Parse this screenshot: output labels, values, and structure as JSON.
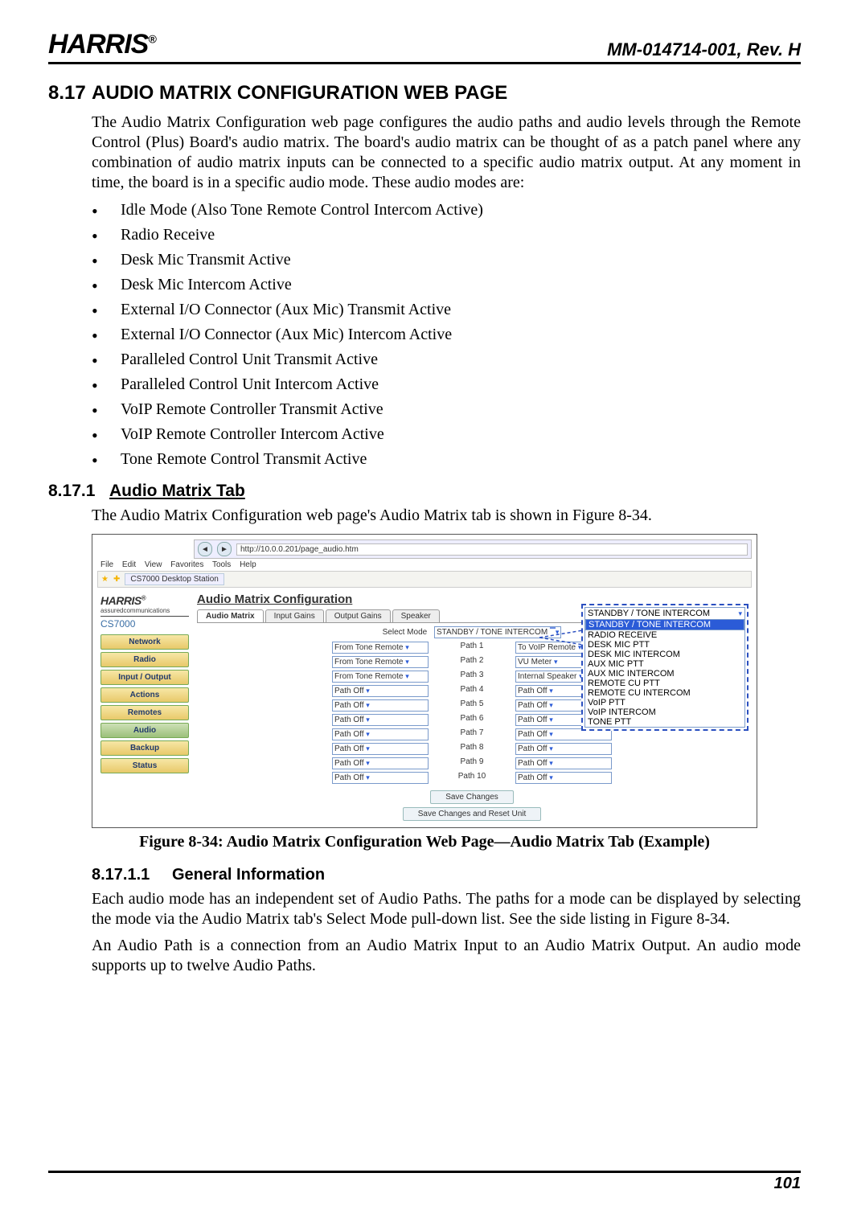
{
  "header": {
    "logo_text": "HARRIS",
    "logo_reg": "®",
    "doc_id": "MM-014714-001, Rev. H"
  },
  "section": {
    "num": "8.17",
    "title": "AUDIO MATRIX CONFIGURATION WEB PAGE",
    "intro": "The Audio Matrix Configuration web page configures the audio paths and audio levels through the Remote Control (Plus) Board's audio matrix.  The board's audio matrix can be thought of as a patch panel where any combination of audio matrix inputs can be connected to a specific audio matrix output.  At any moment in time, the board is in a specific audio mode. These audio modes are:",
    "modes": [
      "Idle Mode (Also Tone Remote Control Intercom Active)",
      "Radio Receive",
      "Desk Mic Transmit Active",
      "Desk Mic Intercom Active",
      "External I/O Connector (Aux Mic) Transmit Active",
      "External I/O Connector (Aux Mic) Intercom Active",
      "Paralleled Control Unit Transmit Active",
      "Paralleled Control Unit Intercom Active",
      "VoIP Remote Controller Transmit Active",
      "VoIP Remote Controller Intercom Active",
      "Tone Remote Control Transmit Active"
    ]
  },
  "sub": {
    "num": "8.17.1",
    "title": "Audio Matrix Tab",
    "text": "The Audio Matrix Configuration web page's Audio Matrix tab is shown in Figure 8-34."
  },
  "figure": {
    "caption": "Figure 8-34:  Audio Matrix Configuration Web Page—Audio Matrix Tab (Example)",
    "browser": {
      "url": "http://10.0.0.201/page_audio.htm",
      "menus": [
        "File",
        "Edit",
        "View",
        "Favorites",
        "Tools",
        "Help"
      ],
      "fav_label": "CS7000 Desktop Station"
    },
    "side": {
      "brand": "HARRIS",
      "brand_reg": "®",
      "tagline": "assuredcommunications",
      "model": "CS7000",
      "items": [
        "Network",
        "Radio",
        "Input / Output",
        "Actions",
        "Remotes",
        "Audio",
        "Backup",
        "Status"
      ],
      "active_index": 5
    },
    "main": {
      "title": "Audio Matrix Configuration",
      "tabs": [
        "Audio Matrix",
        "Input Gains",
        "Output Gains",
        "Speaker"
      ],
      "active_tab": 0,
      "select_mode_label": "Select Mode",
      "select_mode_value": "STANDBY / TONE INTERCOM",
      "paths": [
        {
          "from": "From Tone Remote",
          "label": "Path 1",
          "to": "To VoIP Remote"
        },
        {
          "from": "From Tone Remote",
          "label": "Path 2",
          "to": "VU Meter"
        },
        {
          "from": "From Tone Remote",
          "label": "Path 3",
          "to": "Internal Speaker"
        },
        {
          "from": "Path Off",
          "label": "Path 4",
          "to": "Path Off"
        },
        {
          "from": "Path Off",
          "label": "Path 5",
          "to": "Path Off"
        },
        {
          "from": "Path Off",
          "label": "Path 6",
          "to": "Path Off"
        },
        {
          "from": "Path Off",
          "label": "Path 7",
          "to": "Path Off"
        },
        {
          "from": "Path Off",
          "label": "Path 8",
          "to": "Path Off"
        },
        {
          "from": "Path Off",
          "label": "Path 9",
          "to": "Path Off"
        },
        {
          "from": "Path Off",
          "label": "Path 10",
          "to": "Path Off"
        }
      ],
      "buttons": [
        "Save Changes",
        "Save Changes and Reset Unit"
      ]
    },
    "callout": {
      "selected": "STANDBY / TONE INTERCOM",
      "options": [
        "STANDBY / TONE INTERCOM",
        "RADIO RECEIVE",
        "DESK MIC PTT",
        "DESK MIC INTERCOM",
        "AUX MIC PTT",
        "AUX MIC INTERCOM",
        "REMOTE CU PTT",
        "REMOTE CU INTERCOM",
        "VoIP PTT",
        "VoIP INTERCOM",
        "TONE PTT"
      ]
    }
  },
  "subsub": {
    "num": "8.17.1.1",
    "title": "General Information",
    "p1": "Each audio mode has an independent set of Audio Paths. The paths for a mode can be displayed by selecting the mode via the Audio Matrix tab's Select Mode pull-down list. See the side listing in Figure 8-34.",
    "p2": "An Audio Path is a connection from an Audio Matrix Input to an Audio Matrix Output. An audio mode supports up to twelve Audio Paths."
  },
  "footer": {
    "page_number": "101"
  }
}
